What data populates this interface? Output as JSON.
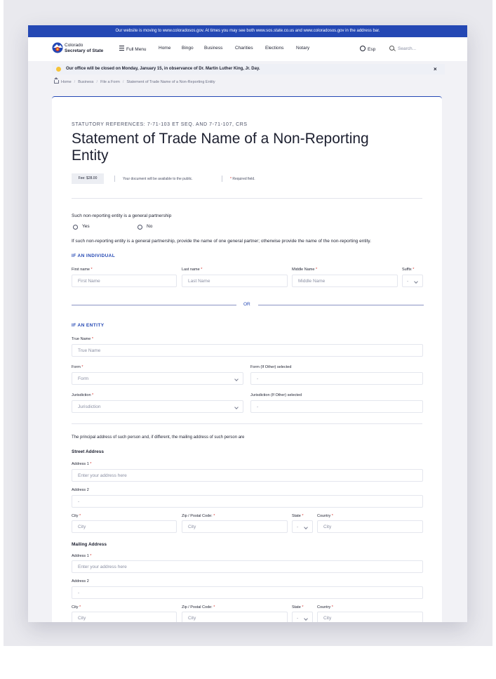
{
  "banner": "Our website is moving to www.coloradosos.gov. At times you may see both www.sos.state.co.us and www.coloradosos.gov in the address bar.",
  "brand": {
    "line1": "Colorado",
    "line2": "Secretary of State"
  },
  "nav": {
    "menu": "Full Menu",
    "links": [
      "Home",
      "Bingo",
      "Business",
      "Charities",
      "Elections",
      "Notary"
    ],
    "lang": "Esp",
    "search_placeholder": "Search..."
  },
  "alert": {
    "message": "Our office will be closed on Monday, January 15, in observance of Dr. Martin Luther King, Jr. Day.",
    "close": "×"
  },
  "breadcrumb": [
    "Home",
    "Business",
    "File a Form",
    "Statement of Trade Name of a Non-Reporting Entity"
  ],
  "form": {
    "refs": "STATUTORY REFERENCES: 7-71-103 ET SEQ. AND 7-71-107, CRS",
    "title": "Statement of Trade Name of a Non-Reporting Entity",
    "fee": "Fee: $28.00",
    "public_note": "Your document will be available to the public.",
    "required_note": "Required field.",
    "question": "Such non-reporting entity is a general partnership",
    "options": [
      "Yes",
      "No"
    ],
    "instruction": "If such non-reporting entity is a general partnership, provide the name of one general partner; otherwise provide the name of the non-reporting entity.",
    "individual": {
      "heading": "IF AN INDIVIDUAL",
      "first_label": "First name",
      "first_placeholder": "First Name",
      "last_label": "Last name",
      "last_placeholder": "Last Name",
      "middle_label": "Middle Name",
      "middle_placeholder": "Middle Name",
      "suffix_label": "Suffix",
      "suffix_value": "-"
    },
    "or": "OR",
    "entity": {
      "heading": "IF AN ENTITY",
      "true_name_label": "True Name",
      "true_name_placeholder": "True Name",
      "form_label": "Form",
      "form_value": "Form",
      "form_other_label": "Form (If Other) selected",
      "form_other_value": "-",
      "jurisdiction_label": "Jurisdiction",
      "jurisdiction_value": "Jurisdiction",
      "jurisdiction_other_label": "Jurisdiction (If Other) selected",
      "jurisdiction_other_value": "-"
    },
    "address_intro": "The principal address of such person and, if different, the mailing address of such person are",
    "street": {
      "heading": "Street Address",
      "address1_label": "Address 1",
      "address1_placeholder": "Enter your address here",
      "address2_label": "Address 2",
      "address2_value": "-",
      "city_label": "City",
      "city_placeholder": "City",
      "zip_label": "Zip / Postal Code:",
      "zip_placeholder": "City",
      "state_label": "State",
      "state_value": "-",
      "country_label": "Country",
      "country_placeholder": "City"
    },
    "mailing": {
      "heading": "Mailing Address",
      "address1_label": "Address 1",
      "address1_placeholder": "Enter your address here",
      "address2_label": "Address 2",
      "address2_value": "-",
      "city_label": "City",
      "city_placeholder": "City",
      "zip_label": "Zip / Postal Code:",
      "zip_placeholder": "City",
      "state_label": "State",
      "state_value": "-",
      "country_label": "Country",
      "country_placeholder": "City"
    }
  },
  "colors": {
    "primary": "#2448b4",
    "alert_dot": "#f6c338",
    "required": "#d6322b"
  }
}
